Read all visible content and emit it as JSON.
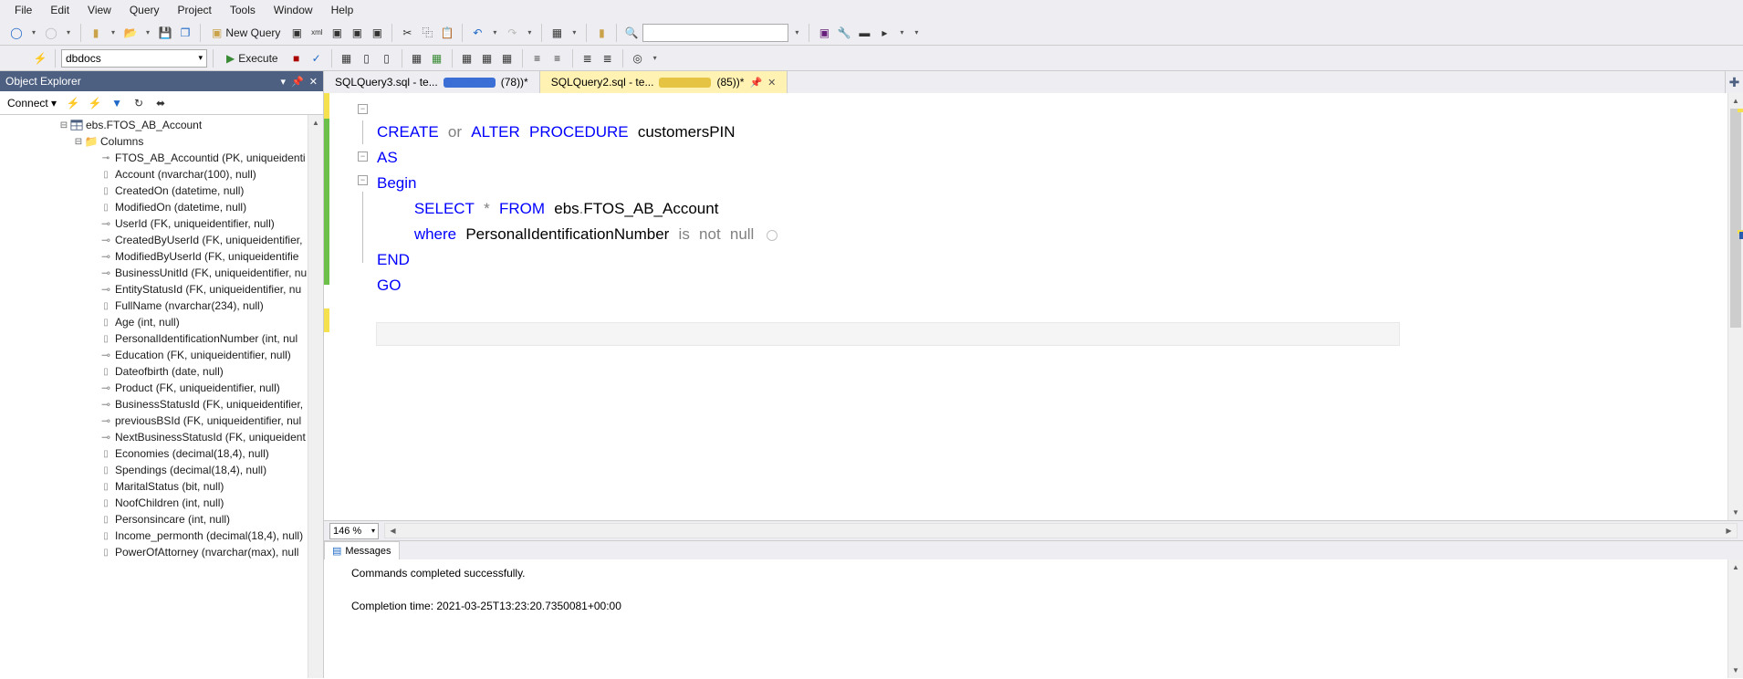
{
  "menu": [
    "File",
    "Edit",
    "View",
    "Query",
    "Project",
    "Tools",
    "Window",
    "Help"
  ],
  "toolbar": {
    "new_query": "New Query",
    "execute": "Execute",
    "database": "dbdocs"
  },
  "object_explorer": {
    "title": "Object Explorer",
    "connect": "Connect",
    "table": "ebs.FTOS_AB_Account",
    "columns_folder": "Columns",
    "columns": [
      {
        "name": "FTOS_AB_Accountid (PK, uniqueidenti",
        "kind": "pk"
      },
      {
        "name": "Account (nvarchar(100), null)",
        "kind": "col"
      },
      {
        "name": "CreatedOn (datetime, null)",
        "kind": "col"
      },
      {
        "name": "ModifiedOn (datetime, null)",
        "kind": "col"
      },
      {
        "name": "UserId (FK, uniqueidentifier, null)",
        "kind": "fk"
      },
      {
        "name": "CreatedByUserId (FK, uniqueidentifier,",
        "kind": "fk"
      },
      {
        "name": "ModifiedByUserId (FK, uniqueidentifie",
        "kind": "fk"
      },
      {
        "name": "BusinessUnitId (FK, uniqueidentifier, nu",
        "kind": "fk"
      },
      {
        "name": "EntityStatusId (FK, uniqueidentifier, nu",
        "kind": "fk"
      },
      {
        "name": "FullName (nvarchar(234), null)",
        "kind": "col"
      },
      {
        "name": "Age (int, null)",
        "kind": "col"
      },
      {
        "name": "PersonalIdentificationNumber (int, nul",
        "kind": "col"
      },
      {
        "name": "Education (FK, uniqueidentifier, null)",
        "kind": "fk"
      },
      {
        "name": "Dateofbirth (date, null)",
        "kind": "col"
      },
      {
        "name": "Product (FK, uniqueidentifier, null)",
        "kind": "fk"
      },
      {
        "name": "BusinessStatusId (FK, uniqueidentifier,",
        "kind": "fk"
      },
      {
        "name": "previousBSId (FK, uniqueidentifier, nul",
        "kind": "fk"
      },
      {
        "name": "NextBusinessStatusId (FK, uniqueident",
        "kind": "fk"
      },
      {
        "name": "Economies (decimal(18,4), null)",
        "kind": "col"
      },
      {
        "name": "Spendings (decimal(18,4), null)",
        "kind": "col"
      },
      {
        "name": "MaritalStatus (bit, null)",
        "kind": "col"
      },
      {
        "name": "NoofChildren (int, null)",
        "kind": "col"
      },
      {
        "name": "Personsincare (int, null)",
        "kind": "col"
      },
      {
        "name": "Income_permonth (decimal(18,4), null)",
        "kind": "col"
      },
      {
        "name": "PowerOfAttorney (nvarchar(max), null",
        "kind": "col"
      }
    ]
  },
  "tabs": {
    "t1_name": "SQLQuery3.sql - te...",
    "t1_suffix": "(78))*",
    "t2_name": "SQLQuery2.sql - te...",
    "t2_suffix": "(85))*"
  },
  "sql": {
    "l1a": "CREATE",
    "l1b": "or",
    "l1c": "ALTER",
    "l1d": "PROCEDURE",
    "l1e": "customersPIN",
    "l2": "AS",
    "l3": "Begin",
    "l4a": "SELECT",
    "l4b": "*",
    "l4c": "FROM",
    "l4d": "ebs",
    "l4dot": ".",
    "l4e": "FTOS_AB_Account",
    "l5a": "where",
    "l5b": "PersonalIdentificationNumber",
    "l5c": "is",
    "l5d": "not",
    "l5e": "null",
    "l6": "END",
    "l7": "GO"
  },
  "zoom": "146 %",
  "messages": {
    "tab": "Messages",
    "line1": "Commands completed successfully.",
    "line2": "Completion time: 2021-03-25T13:23:20.7350081+00:00"
  }
}
